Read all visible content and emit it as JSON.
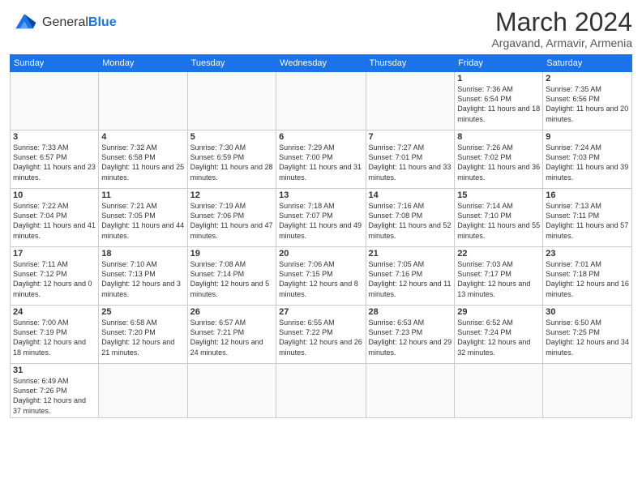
{
  "header": {
    "logo_general": "General",
    "logo_blue": "Blue",
    "title": "March 2024",
    "subtitle": "Argavand, Armavir, Armenia"
  },
  "weekdays": [
    "Sunday",
    "Monday",
    "Tuesday",
    "Wednesday",
    "Thursday",
    "Friday",
    "Saturday"
  ],
  "weeks": [
    [
      {
        "day": "",
        "info": ""
      },
      {
        "day": "",
        "info": ""
      },
      {
        "day": "",
        "info": ""
      },
      {
        "day": "",
        "info": ""
      },
      {
        "day": "",
        "info": ""
      },
      {
        "day": "1",
        "info": "Sunrise: 7:36 AM\nSunset: 6:54 PM\nDaylight: 11 hours and 18 minutes."
      },
      {
        "day": "2",
        "info": "Sunrise: 7:35 AM\nSunset: 6:56 PM\nDaylight: 11 hours and 20 minutes."
      }
    ],
    [
      {
        "day": "3",
        "info": "Sunrise: 7:33 AM\nSunset: 6:57 PM\nDaylight: 11 hours and 23 minutes."
      },
      {
        "day": "4",
        "info": "Sunrise: 7:32 AM\nSunset: 6:58 PM\nDaylight: 11 hours and 25 minutes."
      },
      {
        "day": "5",
        "info": "Sunrise: 7:30 AM\nSunset: 6:59 PM\nDaylight: 11 hours and 28 minutes."
      },
      {
        "day": "6",
        "info": "Sunrise: 7:29 AM\nSunset: 7:00 PM\nDaylight: 11 hours and 31 minutes."
      },
      {
        "day": "7",
        "info": "Sunrise: 7:27 AM\nSunset: 7:01 PM\nDaylight: 11 hours and 33 minutes."
      },
      {
        "day": "8",
        "info": "Sunrise: 7:26 AM\nSunset: 7:02 PM\nDaylight: 11 hours and 36 minutes."
      },
      {
        "day": "9",
        "info": "Sunrise: 7:24 AM\nSunset: 7:03 PM\nDaylight: 11 hours and 39 minutes."
      }
    ],
    [
      {
        "day": "10",
        "info": "Sunrise: 7:22 AM\nSunset: 7:04 PM\nDaylight: 11 hours and 41 minutes."
      },
      {
        "day": "11",
        "info": "Sunrise: 7:21 AM\nSunset: 7:05 PM\nDaylight: 11 hours and 44 minutes."
      },
      {
        "day": "12",
        "info": "Sunrise: 7:19 AM\nSunset: 7:06 PM\nDaylight: 11 hours and 47 minutes."
      },
      {
        "day": "13",
        "info": "Sunrise: 7:18 AM\nSunset: 7:07 PM\nDaylight: 11 hours and 49 minutes."
      },
      {
        "day": "14",
        "info": "Sunrise: 7:16 AM\nSunset: 7:08 PM\nDaylight: 11 hours and 52 minutes."
      },
      {
        "day": "15",
        "info": "Sunrise: 7:14 AM\nSunset: 7:10 PM\nDaylight: 11 hours and 55 minutes."
      },
      {
        "day": "16",
        "info": "Sunrise: 7:13 AM\nSunset: 7:11 PM\nDaylight: 11 hours and 57 minutes."
      }
    ],
    [
      {
        "day": "17",
        "info": "Sunrise: 7:11 AM\nSunset: 7:12 PM\nDaylight: 12 hours and 0 minutes."
      },
      {
        "day": "18",
        "info": "Sunrise: 7:10 AM\nSunset: 7:13 PM\nDaylight: 12 hours and 3 minutes."
      },
      {
        "day": "19",
        "info": "Sunrise: 7:08 AM\nSunset: 7:14 PM\nDaylight: 12 hours and 5 minutes."
      },
      {
        "day": "20",
        "info": "Sunrise: 7:06 AM\nSunset: 7:15 PM\nDaylight: 12 hours and 8 minutes."
      },
      {
        "day": "21",
        "info": "Sunrise: 7:05 AM\nSunset: 7:16 PM\nDaylight: 12 hours and 11 minutes."
      },
      {
        "day": "22",
        "info": "Sunrise: 7:03 AM\nSunset: 7:17 PM\nDaylight: 12 hours and 13 minutes."
      },
      {
        "day": "23",
        "info": "Sunrise: 7:01 AM\nSunset: 7:18 PM\nDaylight: 12 hours and 16 minutes."
      }
    ],
    [
      {
        "day": "24",
        "info": "Sunrise: 7:00 AM\nSunset: 7:19 PM\nDaylight: 12 hours and 18 minutes."
      },
      {
        "day": "25",
        "info": "Sunrise: 6:58 AM\nSunset: 7:20 PM\nDaylight: 12 hours and 21 minutes."
      },
      {
        "day": "26",
        "info": "Sunrise: 6:57 AM\nSunset: 7:21 PM\nDaylight: 12 hours and 24 minutes."
      },
      {
        "day": "27",
        "info": "Sunrise: 6:55 AM\nSunset: 7:22 PM\nDaylight: 12 hours and 26 minutes."
      },
      {
        "day": "28",
        "info": "Sunrise: 6:53 AM\nSunset: 7:23 PM\nDaylight: 12 hours and 29 minutes."
      },
      {
        "day": "29",
        "info": "Sunrise: 6:52 AM\nSunset: 7:24 PM\nDaylight: 12 hours and 32 minutes."
      },
      {
        "day": "30",
        "info": "Sunrise: 6:50 AM\nSunset: 7:25 PM\nDaylight: 12 hours and 34 minutes."
      }
    ],
    [
      {
        "day": "31",
        "info": "Sunrise: 6:49 AM\nSunset: 7:26 PM\nDaylight: 12 hours and 37 minutes."
      },
      {
        "day": "",
        "info": ""
      },
      {
        "day": "",
        "info": ""
      },
      {
        "day": "",
        "info": ""
      },
      {
        "day": "",
        "info": ""
      },
      {
        "day": "",
        "info": ""
      },
      {
        "day": "",
        "info": ""
      }
    ]
  ]
}
